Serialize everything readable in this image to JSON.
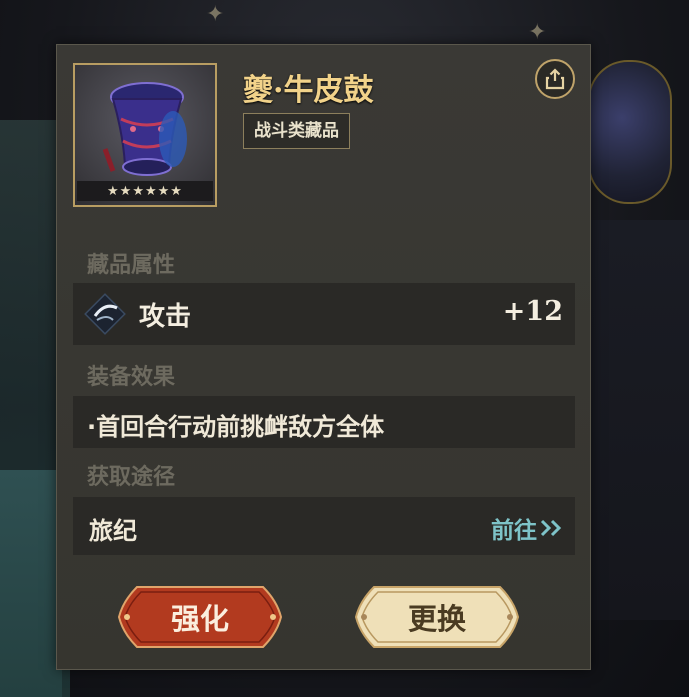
{
  "item": {
    "name": "夔·牛皮鼓",
    "type": "战斗类藏品",
    "stars": "★★★★★★"
  },
  "sections": {
    "attributes_label": "藏品属性",
    "effect_label": "装备效果",
    "source_label": "获取途径"
  },
  "attribute": {
    "icon": "attack-icon",
    "name": "攻击",
    "value": "+12"
  },
  "effect": {
    "text": "·首回合行动前挑衅敌方全体"
  },
  "source": {
    "name": "旅纪",
    "goto_label": "前往"
  },
  "buttons": {
    "enhance_label": "强化",
    "replace_label": "更换"
  },
  "colors": {
    "name_gold": "#f2d38a",
    "link_teal": "#7ec3c8",
    "enhance_red": "#b23a1f",
    "replace_cream": "#efe0b8"
  }
}
